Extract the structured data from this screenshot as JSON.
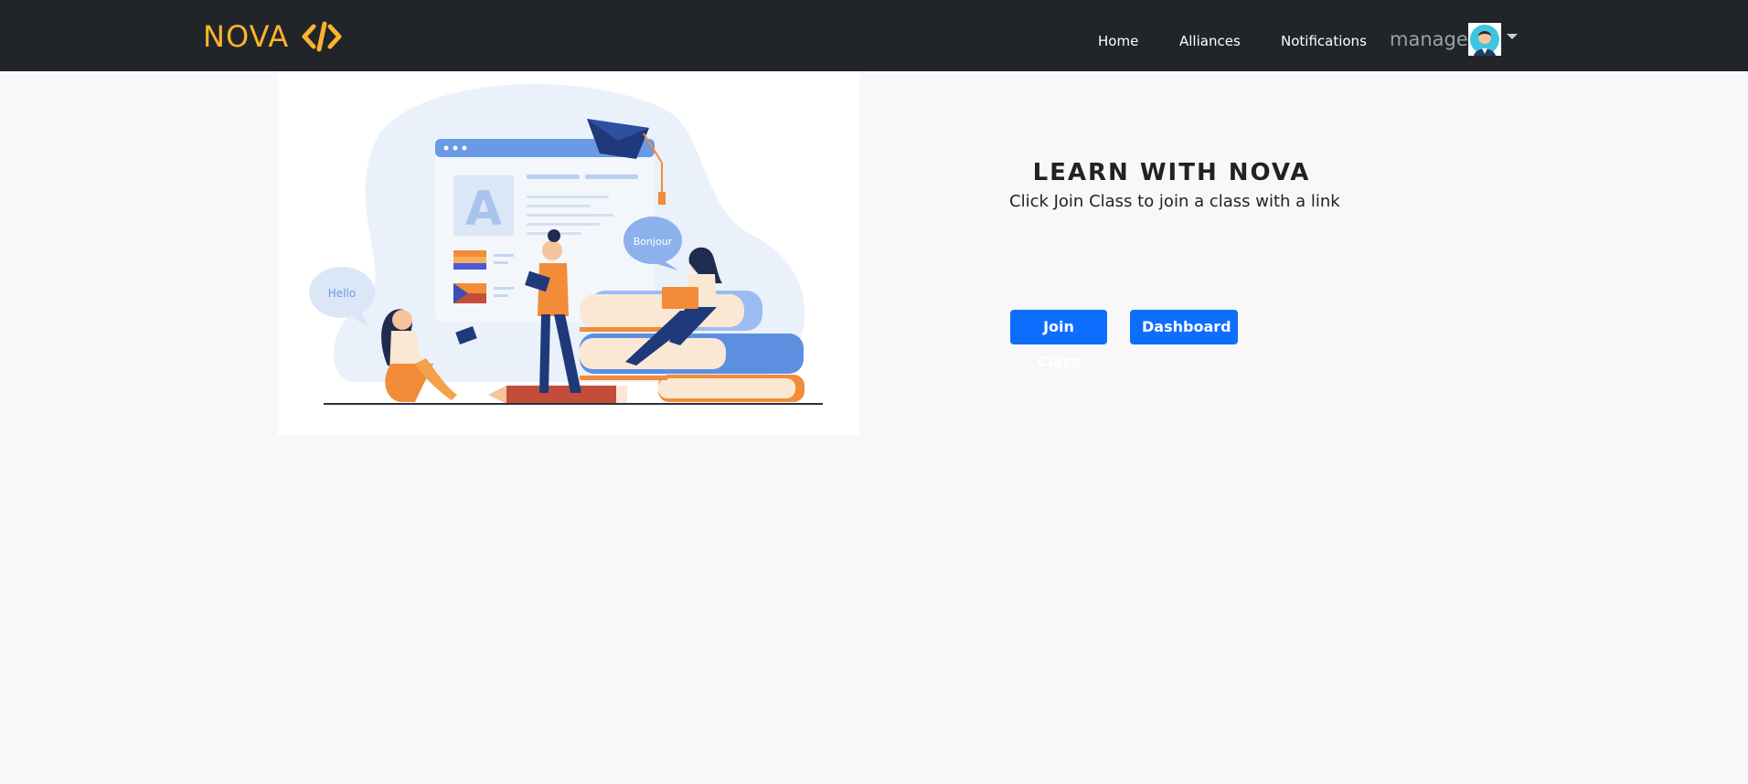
{
  "brand": {
    "name": "NOVA",
    "icon": "code-brackets-icon",
    "color": "#fcb32d"
  },
  "nav": {
    "items": [
      {
        "label": "Home"
      },
      {
        "label": "Alliances"
      },
      {
        "label": "Notifications"
      }
    ],
    "user": {
      "name": "manage",
      "avatar": "user-avatar-icon"
    }
  },
  "hero": {
    "illustration": {
      "bubble_left": "Hello",
      "bubble_right": "Bonjour",
      "letter": "A"
    },
    "title": "LEARN WITH NOVA",
    "subtitle": "Click Join Class to join a class with a link",
    "buttons": {
      "join": "Join Class",
      "dashboard": "Dashboard"
    }
  },
  "colors": {
    "navbar": "#212529",
    "accent": "#fcb32d",
    "primary": "#0d6efd",
    "background": "#f8f8f8"
  }
}
